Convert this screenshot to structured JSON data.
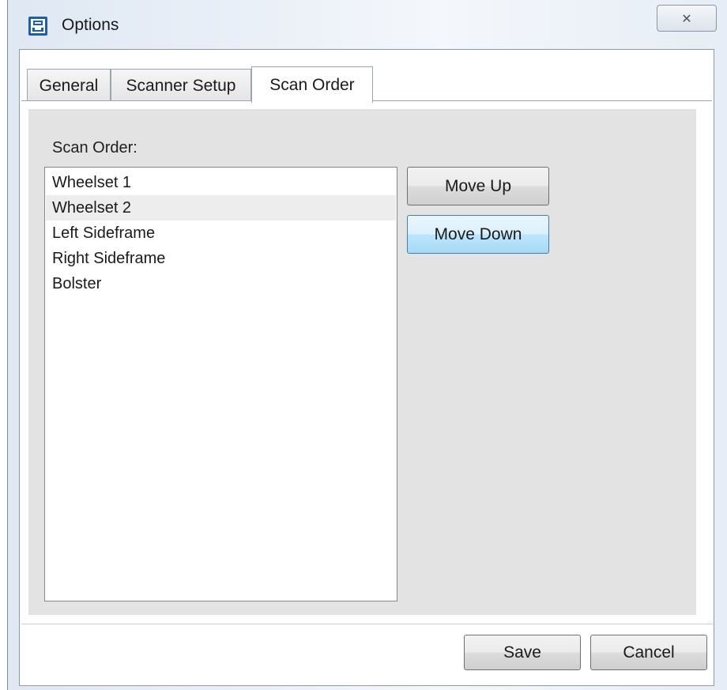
{
  "window": {
    "title": "Options",
    "close_glyph": "✕"
  },
  "tabs": [
    {
      "label": "General"
    },
    {
      "label": "Scanner Setup"
    },
    {
      "label": "Scan Order",
      "active": true
    }
  ],
  "scan_order": {
    "label": "Scan Order:",
    "items": [
      "Wheelset 1",
      "Wheelset 2",
      "Left Sideframe",
      "Right Sideframe",
      "Bolster"
    ],
    "selected_index": 1,
    "move_up_label": "Move Up",
    "move_down_label": "Move Down"
  },
  "footer": {
    "save_label": "Save",
    "cancel_label": "Cancel"
  },
  "colors": {
    "hover_button": "#bee6fd",
    "panel_background": "#e3e3e3",
    "app_icon": "#1f5fa8"
  },
  "icons": {
    "app": "scanner-app-icon",
    "close": "close-icon"
  }
}
